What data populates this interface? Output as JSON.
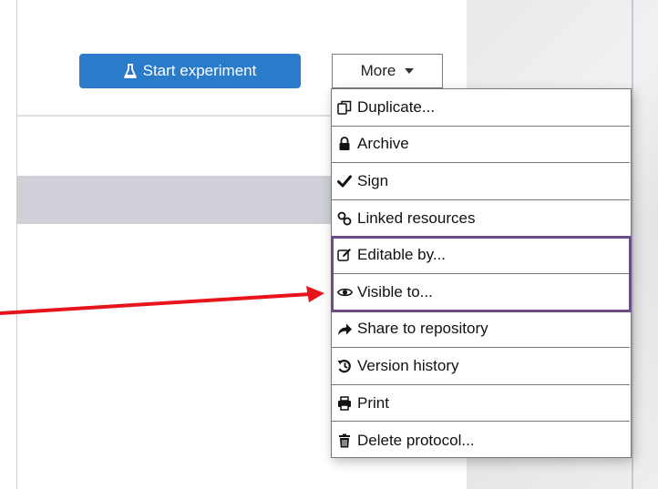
{
  "toolbar": {
    "start_experiment_label": "Start experiment",
    "more_label": "More"
  },
  "menu": {
    "items": [
      {
        "label": "Duplicate...",
        "icon": "duplicate-icon"
      },
      {
        "label": "Archive",
        "icon": "lock-icon"
      },
      {
        "label": "Sign",
        "icon": "checkmark-icon"
      },
      {
        "label": "Linked resources",
        "icon": "link-icon"
      },
      {
        "label": "Editable by...",
        "icon": "edit-icon"
      },
      {
        "label": "Visible to...",
        "icon": "eye-icon"
      },
      {
        "label": "Share to repository",
        "icon": "share-arrow-icon"
      },
      {
        "label": "Version history",
        "icon": "history-icon"
      },
      {
        "label": "Print",
        "icon": "print-icon"
      },
      {
        "label": "Delete protocol...",
        "icon": "trash-icon"
      }
    ]
  },
  "colors": {
    "primary_button": "#2b7bcb",
    "highlight_border": "#6b4b88",
    "annotation_arrow": "#e8141b"
  }
}
